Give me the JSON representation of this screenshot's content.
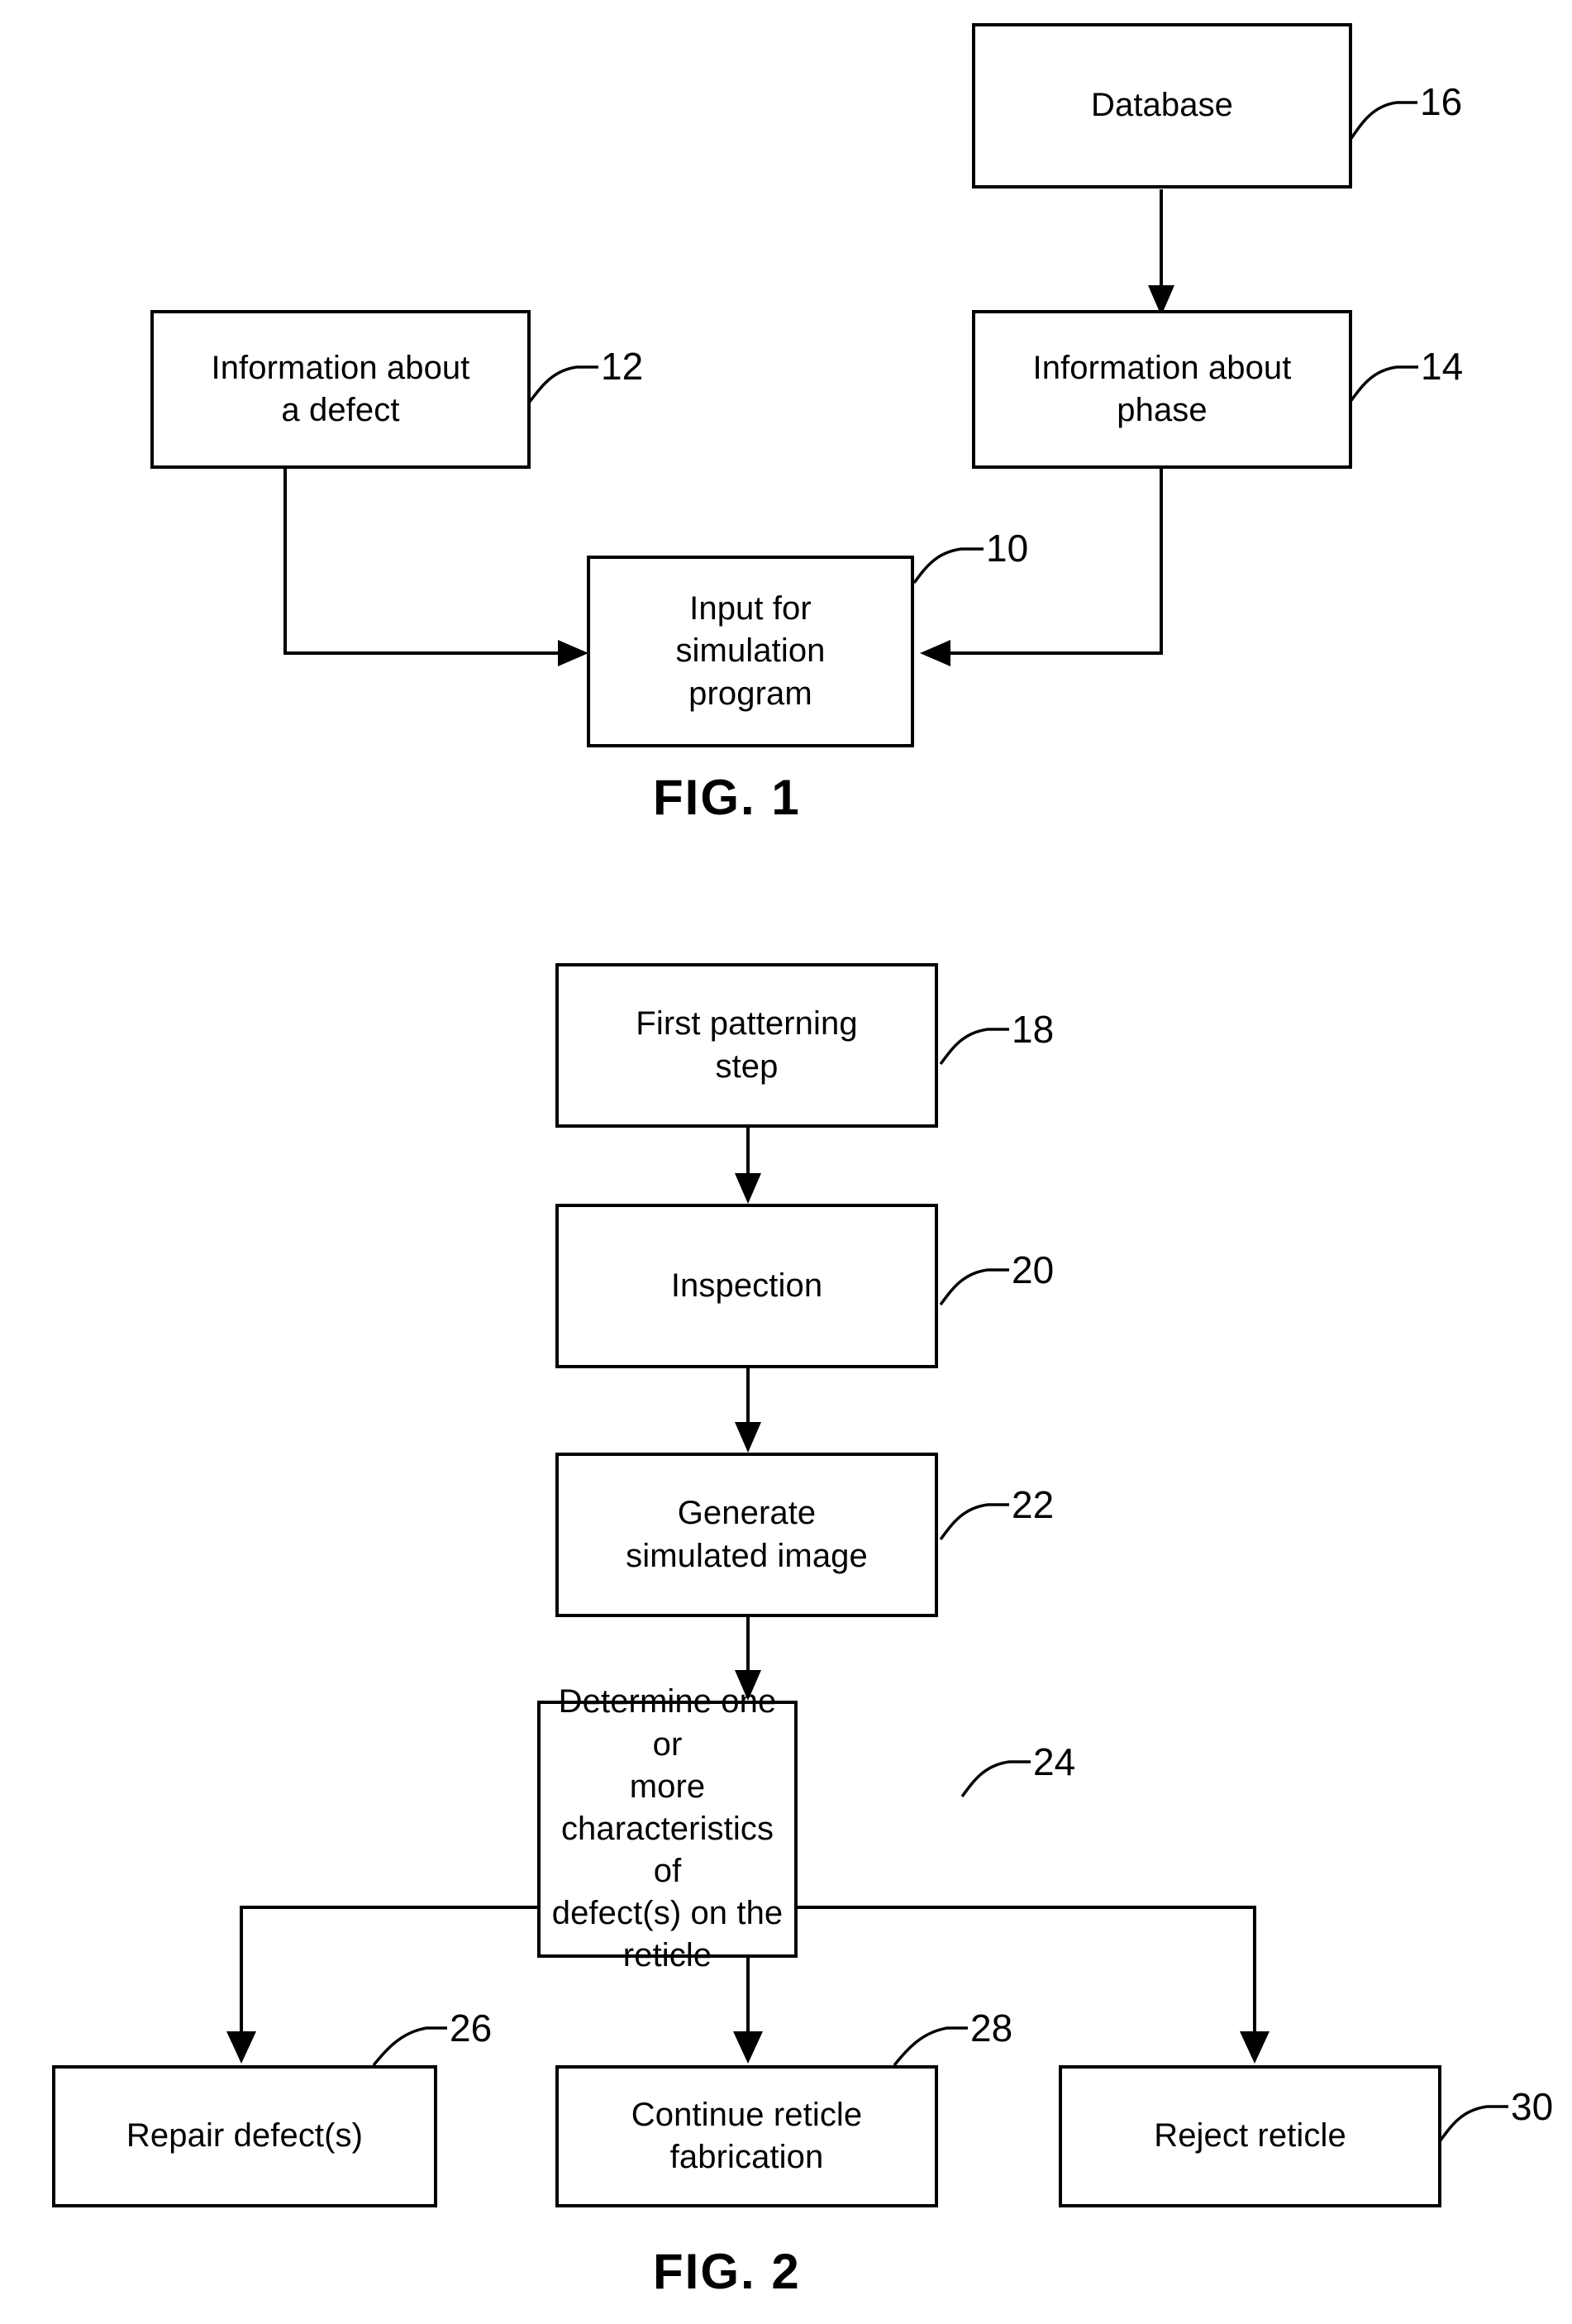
{
  "document": {
    "type": "patent-drawing-sheet",
    "figures": [
      {
        "caption": "FIG. 1",
        "nodes": [
          {
            "ref": "16",
            "label": "Database"
          },
          {
            "ref": "12",
            "label": "Information about\na defect"
          },
          {
            "ref": "14",
            "label": "Information about\nphase"
          },
          {
            "ref": "10",
            "label": "Input for\nsimulation\nprogram"
          }
        ],
        "edges": [
          {
            "from": "16",
            "to": "14"
          },
          {
            "from": "12",
            "to": "10"
          },
          {
            "from": "14",
            "to": "10"
          }
        ]
      },
      {
        "caption": "FIG. 2",
        "nodes": [
          {
            "ref": "18",
            "label": "First patterning\nstep"
          },
          {
            "ref": "20",
            "label": "Inspection"
          },
          {
            "ref": "22",
            "label": "Generate\nsimulated image"
          },
          {
            "ref": "24",
            "label": "Determine one or\nmore\ncharacteristics of\ndefect(s) on the\nreticle"
          },
          {
            "ref": "26",
            "label": "Repair defect(s)"
          },
          {
            "ref": "28",
            "label": "Continue reticle\nfabrication"
          },
          {
            "ref": "30",
            "label": "Reject reticle"
          }
        ],
        "edges": [
          {
            "from": "18",
            "to": "20"
          },
          {
            "from": "20",
            "to": "22"
          },
          {
            "from": "22",
            "to": "24"
          },
          {
            "from": "24",
            "to": "26"
          },
          {
            "from": "24",
            "to": "28"
          },
          {
            "from": "24",
            "to": "30"
          }
        ]
      }
    ]
  },
  "fig1": {
    "caption": "FIG. 1",
    "database": {
      "label": "Database",
      "ref": "16"
    },
    "info_defect": {
      "line1": "Information about",
      "line2": "a defect",
      "ref": "12"
    },
    "info_phase": {
      "line1": "Information about",
      "line2": "phase",
      "ref": "14"
    },
    "input_sim": {
      "line1": "Input for",
      "line2": "simulation",
      "line3": "program",
      "ref": "10"
    }
  },
  "fig2": {
    "caption": "FIG. 2",
    "first_patterning": {
      "line1": "First patterning",
      "line2": "step",
      "ref": "18"
    },
    "inspection": {
      "label": "Inspection",
      "ref": "20"
    },
    "generate_image": {
      "line1": "Generate",
      "line2": "simulated image",
      "ref": "22"
    },
    "determine": {
      "line1": "Determine one or",
      "line2": "more",
      "line3": "characteristics of",
      "line4": "defect(s) on the",
      "line5": "reticle",
      "ref": "24"
    },
    "repair": {
      "label": "Repair defect(s)",
      "ref": "26"
    },
    "continue_fab": {
      "line1": "Continue reticle",
      "line2": "fabrication",
      "ref": "28"
    },
    "reject": {
      "label": "Reject reticle",
      "ref": "30"
    }
  },
  "style": {
    "ink": "#000000",
    "paper": "#ffffff"
  }
}
